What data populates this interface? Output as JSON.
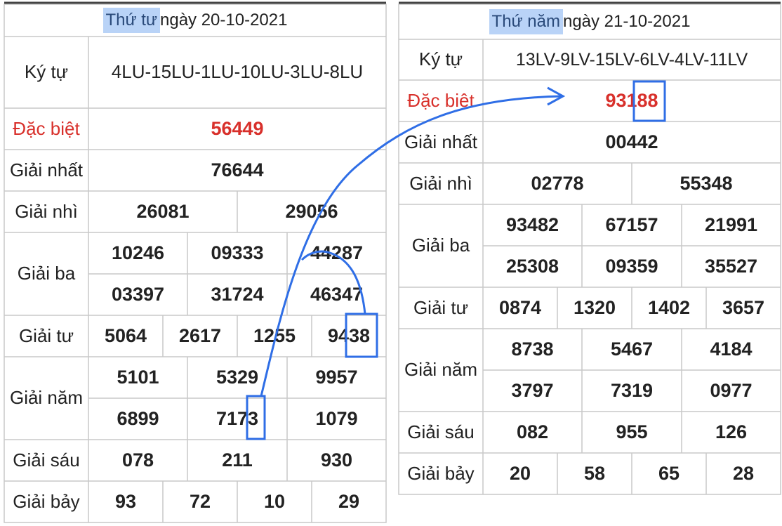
{
  "left": {
    "header_day": "Thứ tư",
    "header_rest": " ngày 20-10-2021",
    "rows": {
      "ky_tu": {
        "label": "Ký tự",
        "value": "4LU-15LU-1LU-10LU-3LU-8LU"
      },
      "dac_biet": {
        "label": "Đặc biệt",
        "value": "56449"
      },
      "giai_nhat": {
        "label": "Giải nhất",
        "value": "76644"
      },
      "giai_nhi": {
        "label": "Giải nhì",
        "values": [
          "26081",
          "29056"
        ]
      },
      "giai_ba": {
        "label": "Giải ba",
        "values": [
          "10246",
          "09333",
          "44287",
          "03397",
          "31724",
          "46347"
        ]
      },
      "giai_tu": {
        "label": "Giải tư",
        "values": [
          "5064",
          "2617",
          "1255",
          "9438"
        ]
      },
      "giai_nam": {
        "label": "Giải năm",
        "values": [
          "5101",
          "5329",
          "9957",
          "6899",
          "7173",
          "1079"
        ]
      },
      "giai_sau": {
        "label": "Giải sáu",
        "values": [
          "078",
          "211",
          "930"
        ]
      },
      "giai_bay": {
        "label": "Giải bảy",
        "values": [
          "93",
          "72",
          "10",
          "29"
        ]
      }
    }
  },
  "right": {
    "header_day": "Thứ năm",
    "header_rest": " ngày 21-10-2021",
    "rows": {
      "ky_tu": {
        "label": "Ký tự",
        "value": "13LV-9LV-15LV-6LV-4LV-11LV"
      },
      "dac_biet": {
        "label": "Đặc biệt",
        "value": "93188"
      },
      "giai_nhat": {
        "label": "Giải nhất",
        "value": "00442"
      },
      "giai_nhi": {
        "label": "Giải nhì",
        "values": [
          "02778",
          "55348"
        ]
      },
      "giai_ba": {
        "label": "Giải ba",
        "values": [
          "93482",
          "67157",
          "21991",
          "25308",
          "09359",
          "35527"
        ]
      },
      "giai_tu": {
        "label": "Giải tư",
        "values": [
          "0874",
          "1320",
          "1402",
          "3657"
        ]
      },
      "giai_nam": {
        "label": "Giải năm",
        "values": [
          "8738",
          "5467",
          "4184",
          "3797",
          "7319",
          "0977"
        ]
      },
      "giai_sau": {
        "label": "Giải sáu",
        "values": [
          "082",
          "955",
          "126"
        ]
      },
      "giai_bay": {
        "label": "Giải bảy",
        "values": [
          "20",
          "58",
          "65",
          "28"
        ]
      }
    }
  },
  "colors": {
    "special": "#d8302b",
    "highlight": "#b9d3f7",
    "annotation": "#2f6ee6",
    "grid": "#c9c9c9"
  }
}
